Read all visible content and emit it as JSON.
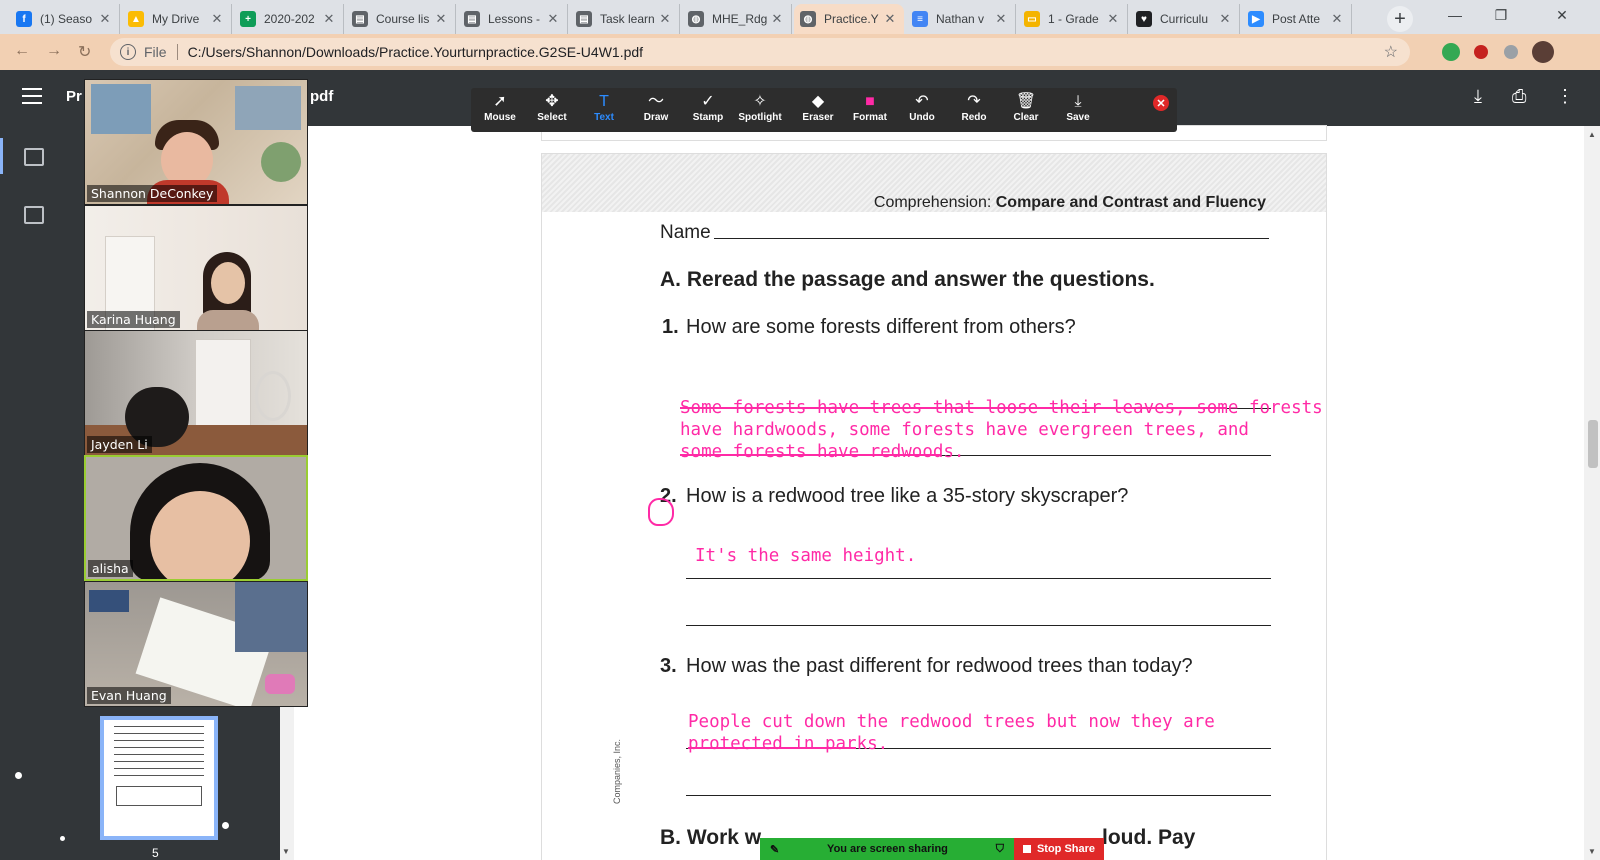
{
  "browser": {
    "tabs": [
      {
        "title": "(1) Seaso",
        "icon": "facebook-icon",
        "color": "#1877f2",
        "glyph": "f"
      },
      {
        "title": "My Drive",
        "icon": "google-drive-icon",
        "color": "#fbbc04",
        "glyph": "▲"
      },
      {
        "title": "2020-202",
        "icon": "google-sheets-icon",
        "color": "#0f9d58",
        "glyph": "+"
      },
      {
        "title": "Course lis",
        "icon": "document-icon",
        "color": "#5f6368",
        "glyph": "▤"
      },
      {
        "title": "Lessons -",
        "icon": "document-icon",
        "color": "#5f6368",
        "glyph": "▤"
      },
      {
        "title": "Task learn",
        "icon": "document-icon",
        "color": "#5f6368",
        "glyph": "▤"
      },
      {
        "title": "MHE_Rdg",
        "icon": "globe-icon",
        "color": "#5f6368",
        "glyph": "◍"
      },
      {
        "title": "Practice.Y",
        "icon": "globe-icon",
        "color": "#5f6368",
        "glyph": "◍"
      },
      {
        "title": "Nathan v",
        "icon": "google-docs-icon",
        "color": "#4285f4",
        "glyph": "≡"
      },
      {
        "title": "1 - Grade",
        "icon": "google-slides-icon",
        "color": "#f4b400",
        "glyph": "▭"
      },
      {
        "title": "Curriculu",
        "icon": "heart-shield-icon",
        "color": "#202124",
        "glyph": "♥"
      },
      {
        "title": "Post Atte",
        "icon": "zoom-icon",
        "color": "#2d8cff",
        "glyph": "▶"
      }
    ],
    "active_tab_index": 7,
    "new_tab_symbol": "+",
    "address": {
      "scheme_label": "File",
      "url": "C:/Users/Shannon/Downloads/Practice.Yourturnpractice.G2SE-U4W1.pdf"
    }
  },
  "pdf_viewer": {
    "title_left": "Pr",
    "title_right": "pdf",
    "thumbnail_page_number": "5"
  },
  "annotation_toolbar": {
    "tools": [
      {
        "label": "Mouse",
        "icon": "cursor-arrow-icon",
        "glyph": "➚"
      },
      {
        "label": "Select",
        "icon": "move-arrows-icon",
        "glyph": "✥"
      },
      {
        "label": "Text",
        "icon": "text-icon",
        "glyph": "T"
      },
      {
        "label": "Draw",
        "icon": "squiggle-icon",
        "glyph": "〜"
      },
      {
        "label": "Stamp",
        "icon": "checkmark-icon",
        "glyph": "✓"
      },
      {
        "label": "Spotlight",
        "icon": "spotlight-icon",
        "glyph": "✧"
      },
      {
        "label": "Eraser",
        "icon": "eraser-icon",
        "glyph": "◆"
      },
      {
        "label": "Format",
        "icon": "format-color-icon",
        "glyph": "■"
      },
      {
        "label": "Undo",
        "icon": "undo-icon",
        "glyph": "↶"
      },
      {
        "label": "Redo",
        "icon": "redo-icon",
        "glyph": "↷"
      },
      {
        "label": "Clear",
        "icon": "trash-icon",
        "glyph": "🗑"
      },
      {
        "label": "Save",
        "icon": "save-download-icon",
        "glyph": "⤓"
      }
    ],
    "active_tool": "Text",
    "format_color": "#ff2aa6",
    "close_symbol": "✕"
  },
  "participants": [
    {
      "name": "Shannon DeConkey",
      "speaking": false
    },
    {
      "name": "Karina Huang",
      "speaking": false
    },
    {
      "name": "Jayden Li",
      "speaking": false
    },
    {
      "name": "alisha",
      "speaking": true
    },
    {
      "name": "Evan Huang",
      "speaking": false
    }
  ],
  "worksheet": {
    "header_prefix": "Comprehension: ",
    "header_bold": "Compare and Contrast and Fluency",
    "name_label": "Name",
    "section_a": "A. Reread the passage and answer the questions.",
    "questions": [
      {
        "number": "1.",
        "text": "How are some forests different from others?"
      },
      {
        "number": "2.",
        "text": "How is a redwood tree like a 35-story skyscraper?"
      },
      {
        "number": "3.",
        "text": "How was the past different for redwood trees than today?"
      }
    ],
    "answers": [
      [
        "Some forests have trees that loose their leaves, some forests",
        "have hardwoods, some forests have evergreen trees, and",
        "some forests have redwoods."
      ],
      [
        "It's the same height."
      ],
      [
        "People cut down the redwood trees but now they are",
        "protected in parks."
      ]
    ],
    "section_b_partial": "B. Work w",
    "section_b_tail": "loud. Pay",
    "copyright_partial": "Companies, Inc.",
    "annotation_color": "#ff2aa6"
  },
  "share_bar": {
    "status": "You are screen sharing",
    "stop_label": "Stop Share"
  }
}
